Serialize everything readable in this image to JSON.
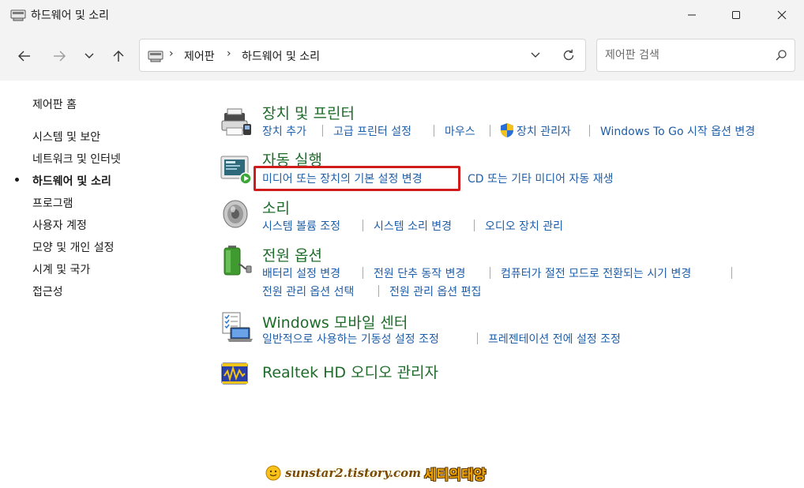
{
  "window": {
    "title": "하드웨어 및 소리"
  },
  "toolbar": {
    "back_icon": "back-arrow-icon",
    "forward_icon": "forward-arrow-icon",
    "recent_icon": "chevron-down-icon",
    "up_icon": "up-arrow-icon",
    "breadcrumb": [
      "제어판",
      "하드웨어 및 소리"
    ],
    "search_placeholder": "제어판 검색"
  },
  "sidebar": {
    "items": [
      {
        "label": "제어판 홈"
      },
      {
        "label": "시스템 및 보안"
      },
      {
        "label": "네트워크 및 인터넷"
      },
      {
        "label": "하드웨어 및 소리",
        "active": true
      },
      {
        "label": "프로그램"
      },
      {
        "label": "사용자 계정"
      },
      {
        "label": "모양 및 개인 설정"
      },
      {
        "label": "시계 및 국가"
      },
      {
        "label": "접근성"
      }
    ]
  },
  "categories": [
    {
      "title": "장치 및 프린터",
      "icon": "printer-icon",
      "tasks": [
        "장치 추가",
        "고급 프린터 설정",
        "마우스",
        "장치 관리자",
        "Windows To Go 시작 옵션 변경"
      ]
    },
    {
      "title": "자동 실행",
      "icon": "autoplay-icon",
      "tasks": [
        "미디어 또는 장치의 기본 설정 변경",
        "CD 또는 기타 미디어 자동 재생"
      ]
    },
    {
      "title": "소리",
      "icon": "speaker-icon",
      "tasks": [
        "시스템 볼륨 조정",
        "시스템 소리 변경",
        "오디오 장치 관리"
      ]
    },
    {
      "title": "전원 옵션",
      "icon": "battery-icon",
      "tasks": [
        "배터리 설정 변경",
        "전원 단추 동작 변경",
        "컴퓨터가 절전 모드로 전환되는 시기 변경",
        "전원 관리 옵션 선택",
        "전원 관리 옵션 편집"
      ]
    },
    {
      "title": "Windows 모바일 센터",
      "icon": "mobility-center-icon",
      "tasks": [
        "일반적으로 사용하는 기동성 설정 조정",
        "프레젠테이션 전에 설정 조정"
      ]
    },
    {
      "title": "Realtek HD 오디오 관리자",
      "icon": "realtek-audio-icon",
      "tasks": []
    }
  ],
  "watermark": {
    "url": "sunstar2.tistory.com",
    "name": "세티의태양"
  },
  "colors": {
    "category_title": "#1e6b2a",
    "task_link": "#1f5ea8",
    "highlight_box": "#d11c1c",
    "chrome_bg": "#f3f3f3"
  }
}
